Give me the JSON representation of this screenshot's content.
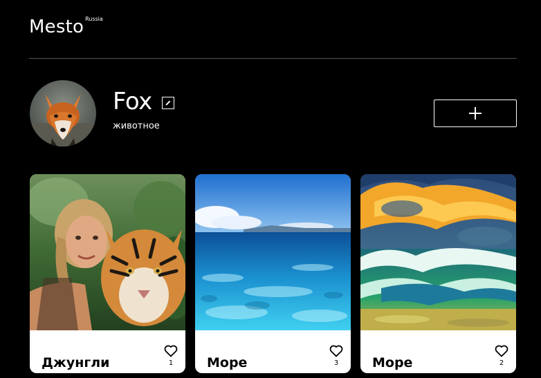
{
  "header": {
    "logo": "Mesto",
    "logo_sup": "Russia"
  },
  "profile": {
    "name": "Fox",
    "about": "животное",
    "edit_icon": "pencil-icon",
    "add_icon": "plus-icon"
  },
  "cards": [
    {
      "title": "Джунгли",
      "likes": "1",
      "image": "jungle-selfie-with-tiger"
    },
    {
      "title": "Море",
      "likes": "3",
      "image": "clear-blue-sea"
    },
    {
      "title": "Море",
      "likes": "2",
      "image": "stormy-sea-waves-sunset"
    }
  ],
  "colors": {
    "background": "#000000",
    "card": "#ffffff",
    "divider": "#545454",
    "text_on_dark": "#ffffff",
    "text_on_card": "#000000"
  }
}
